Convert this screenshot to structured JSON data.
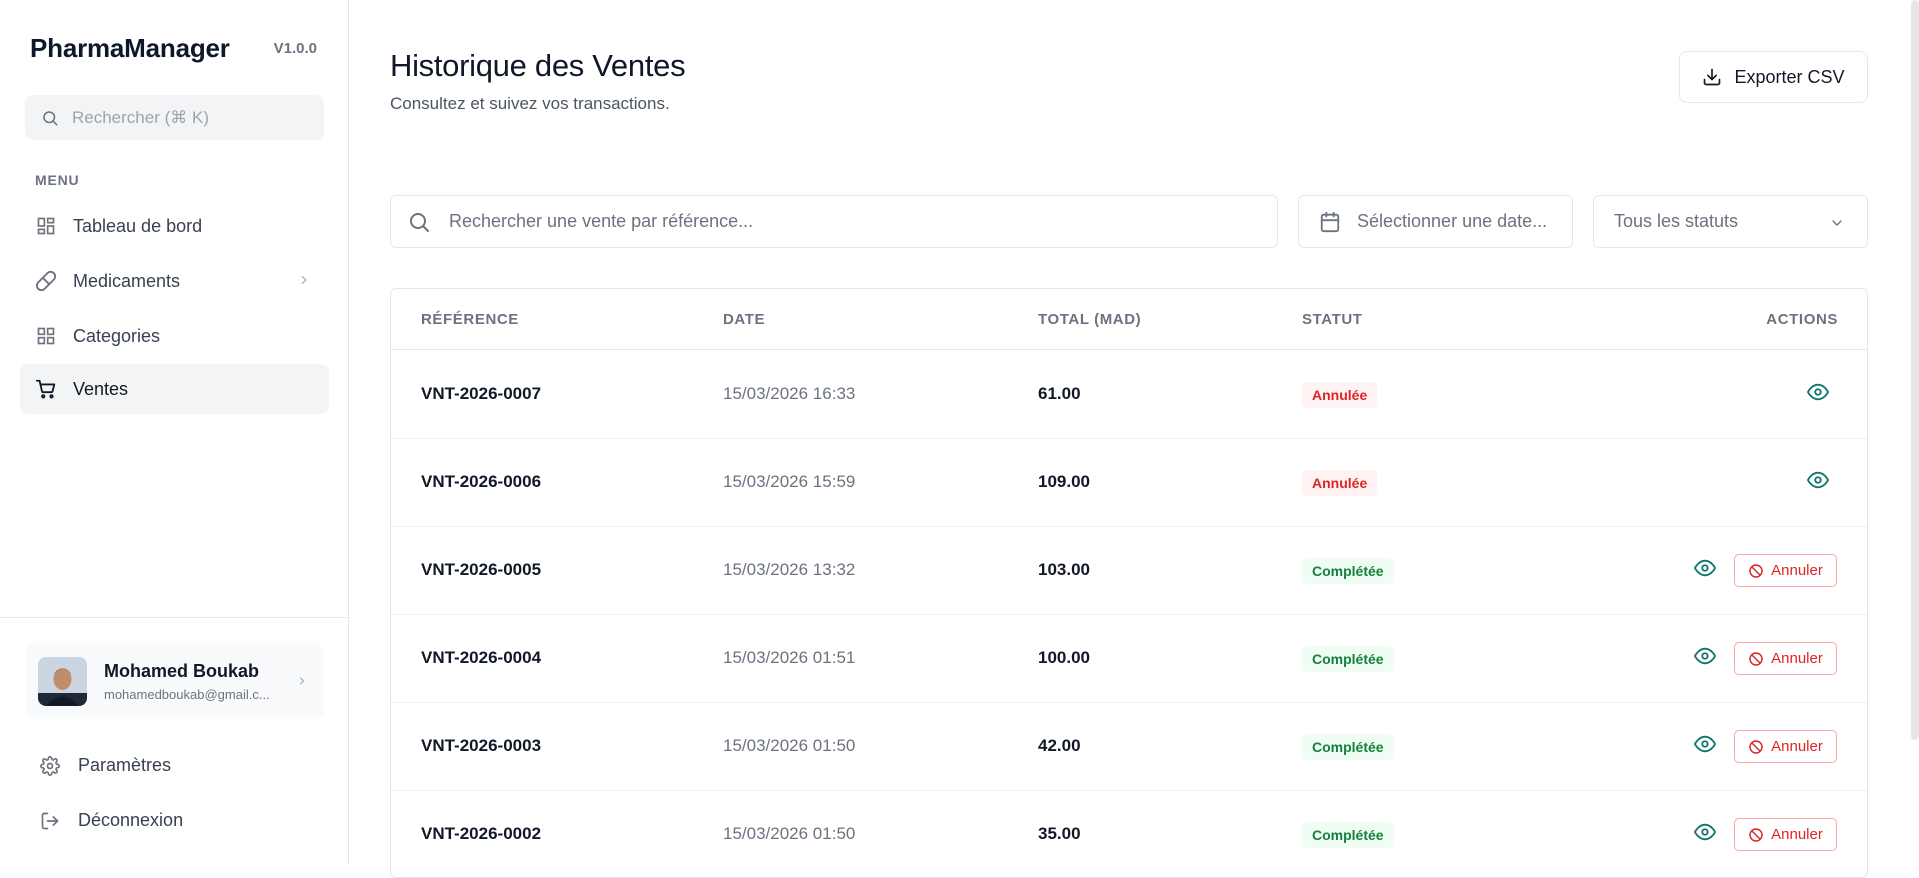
{
  "app": {
    "name": "PharmaManager",
    "version": "V1.0.0"
  },
  "sidebar": {
    "search_placeholder": "Rechercher (⌘ K)",
    "menu_label": "MENU",
    "items": [
      {
        "label": "Tableau de bord",
        "icon": "grid-icon"
      },
      {
        "label": "Medicaments",
        "icon": "pill-icon"
      },
      {
        "label": "Categories",
        "icon": "grid-icon"
      },
      {
        "label": "Ventes",
        "icon": "cart-icon",
        "active": true
      }
    ],
    "user": {
      "name": "Mohamed Boukab",
      "email": "mohamedboukab@gmail.c..."
    },
    "footer": [
      {
        "label": "Paramètres",
        "icon": "gear-icon"
      },
      {
        "label": "Déconnexion",
        "icon": "logout-icon"
      }
    ]
  },
  "header": {
    "title": "Historique des Ventes",
    "subtitle": "Consultez et suivez vos transactions.",
    "export_label": "Exporter CSV"
  },
  "filters": {
    "search_placeholder": "Rechercher une vente par référence...",
    "date_placeholder": "Sélectionner une date...",
    "status_value": "Tous les statuts"
  },
  "table": {
    "columns": [
      "RÉFÉRENCE",
      "DATE",
      "TOTAL (MAD)",
      "STATUT",
      "ACTIONS"
    ],
    "cancel_label": "Annuler",
    "rows": [
      {
        "ref": "VNT-2026-0007",
        "date": "15/03/2026 16:33",
        "total": "61.00",
        "status": "Annulée"
      },
      {
        "ref": "VNT-2026-0006",
        "date": "15/03/2026 15:59",
        "total": "109.00",
        "status": "Annulée"
      },
      {
        "ref": "VNT-2026-0005",
        "date": "15/03/2026 13:32",
        "total": "103.00",
        "status": "Complétée"
      },
      {
        "ref": "VNT-2026-0004",
        "date": "15/03/2026 01:51",
        "total": "100.00",
        "status": "Complétée"
      },
      {
        "ref": "VNT-2026-0003",
        "date": "15/03/2026 01:50",
        "total": "42.00",
        "status": "Complétée"
      },
      {
        "ref": "VNT-2026-0002",
        "date": "15/03/2026 01:50",
        "total": "35.00",
        "status": "Complétée"
      }
    ]
  },
  "colors": {
    "accent": "#0f766e",
    "danger": "#dc2626",
    "success": "#15803d"
  }
}
